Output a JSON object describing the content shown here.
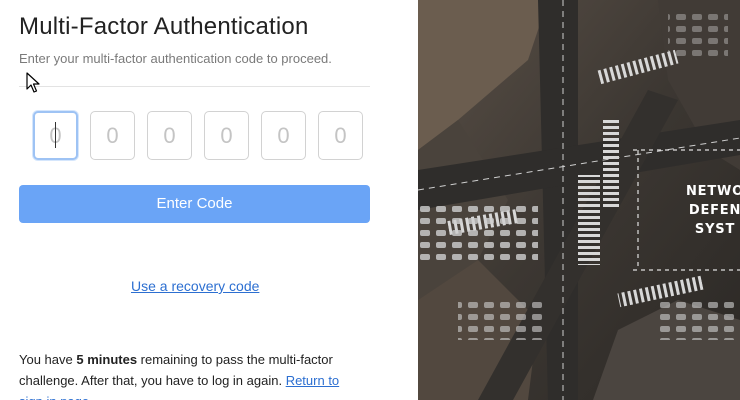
{
  "auth": {
    "title": "Multi-Factor Authentication",
    "subtitle": "Enter your multi-factor authentication code to proceed.",
    "code_inputs": [
      {
        "placeholder": "0"
      },
      {
        "placeholder": "0"
      },
      {
        "placeholder": "0"
      },
      {
        "placeholder": "0"
      },
      {
        "placeholder": "0"
      },
      {
        "placeholder": "0"
      }
    ],
    "submit_label": "Enter Code",
    "recovery_link": "Use a recovery code",
    "note": {
      "prefix": "You have ",
      "time": "5 minutes",
      "middle": " remaining to pass the multi-factor challenge. After that, you have to log in again. ",
      "link": "Return to sign in page"
    }
  },
  "banner": {
    "lines": [
      "NETWO",
      "DEFEN",
      "SYST"
    ]
  },
  "colors": {
    "accent": "#6aa4f6",
    "link": "#2c6fd1",
    "focus_border": "#9ec3f4"
  }
}
